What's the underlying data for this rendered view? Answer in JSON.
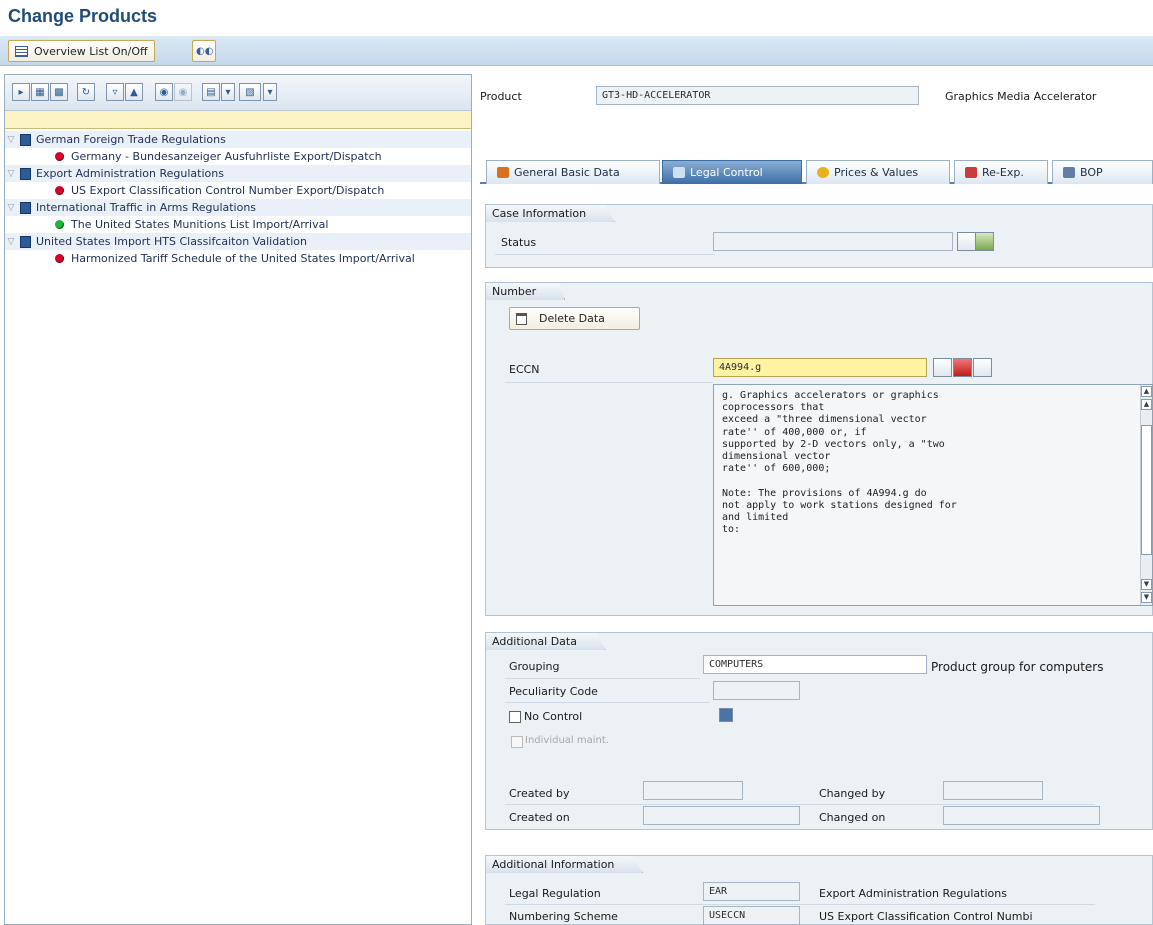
{
  "page": {
    "title": "Change Products"
  },
  "appbar": {
    "overview_label": "Overview List On/Off"
  },
  "tree": {
    "items": [
      {
        "label": "German Foreign Trade Regulations",
        "kind": "folder"
      },
      {
        "label": "Germany - Bundesanzeiger Ausfuhrliste Export/Dispatch",
        "kind": "red"
      },
      {
        "label": "Export Administration Regulations",
        "kind": "folder"
      },
      {
        "label": "US Export Classification Control Number Export/Dispatch",
        "kind": "red"
      },
      {
        "label": "International Traffic in Arms Regulations",
        "kind": "folder"
      },
      {
        "label": "The United States Munitions List Import/Arrival",
        "kind": "green"
      },
      {
        "label": "United States Import HTS Classifcaiton Validation",
        "kind": "folder"
      },
      {
        "label": "Harmonized Tariff Schedule of the United States Import/Arrival",
        "kind": "red"
      }
    ]
  },
  "product": {
    "label": "Product",
    "value": "GT3-HD-ACCELERATOR",
    "description": "Graphics Media Accelerator"
  },
  "tabs": [
    {
      "label": "General Basic Data"
    },
    {
      "label": "Legal Control"
    },
    {
      "label": "Prices & Values"
    },
    {
      "label": "Re-Exp."
    },
    {
      "label": "BOP"
    }
  ],
  "case_info": {
    "header": "Case Information",
    "status_label": "Status",
    "status_value": ""
  },
  "number": {
    "header": "Number",
    "delete_label": "Delete Data",
    "eccn_label": "ECCN",
    "eccn_value": "4A994.g",
    "eccn_text": "g. Graphics accelerators or graphics\ncoprocessors that\nexceed a \"three dimensional vector\nrate'' of 400,000 or, if\nsupported by 2-D vectors only, a \"two\ndimensional vector\nrate'' of 600,000;\n\nNote: The provisions of 4A994.g do\nnot apply to work stations designed for\nand limited\nto:"
  },
  "additional_data": {
    "header": "Additional Data",
    "grouping_label": "Grouping",
    "grouping_value": "COMPUTERS",
    "grouping_desc": "Product group for computers",
    "peculiarity_label": "Peculiarity Code",
    "no_control_label": "No Control",
    "individual_label": "Individual maint.",
    "created_by_label": "Created by",
    "created_on_label": "Created on",
    "changed_by_label": "Changed by",
    "changed_on_label": "Changed on"
  },
  "additional_info": {
    "header": "Additional Information",
    "legal_regulation_label": "Legal Regulation",
    "legal_regulation_value": "EAR",
    "legal_regulation_desc": "Export Administration Regulations",
    "numbering_label": "Numbering Scheme",
    "numbering_value": "USECCN",
    "numbering_desc": "US Export Classification Control Numbi"
  },
  "colors": {
    "title": "#1f4d7a",
    "active_tab": "#3c6ea6",
    "required_field": "#fff3a3"
  }
}
